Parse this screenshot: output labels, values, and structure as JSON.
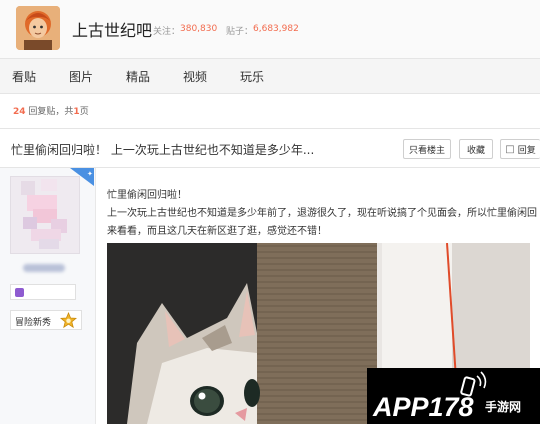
{
  "forum": {
    "name": "上古世纪吧",
    "follow_label": "关注：",
    "follow_count": "380,830",
    "posts_label": "贴子：",
    "posts_count": "6,683,982"
  },
  "tabs": [
    {
      "label": "看贴"
    },
    {
      "label": "图片"
    },
    {
      "label": "精品"
    },
    {
      "label": "视频"
    },
    {
      "label": "玩乐"
    }
  ],
  "reply_meta": {
    "count": "24",
    "replies_label": "回复贴，共",
    "pages": "1",
    "pages_suffix": "页"
  },
  "thread": {
    "title": "忙里偷闲回归啦！ 上一次玩上古世纪也不知道是多少年...",
    "buttons": {
      "only_op": "只看楼主",
      "favorite": "收藏",
      "reply": "回复"
    }
  },
  "author": {
    "rank_label": "冒险新秀",
    "rank_icon": "star-badge-icon"
  },
  "post": {
    "line1": "忙里偷闲回归啦！",
    "line2": "上一次玩上古世纪也不知道是多少年前了，退游很久了，现在听说搞了个见面会，所以忙里偷闲回来看看，而且这几天在新区逛了逛，感觉还不错！"
  },
  "watermark": {
    "brand": "APP178",
    "suffix": "手游网"
  },
  "colors": {
    "accent": "#f26c4f",
    "watermark_brand": "#ffffff",
    "tab_bar": "#f5f5f5"
  }
}
